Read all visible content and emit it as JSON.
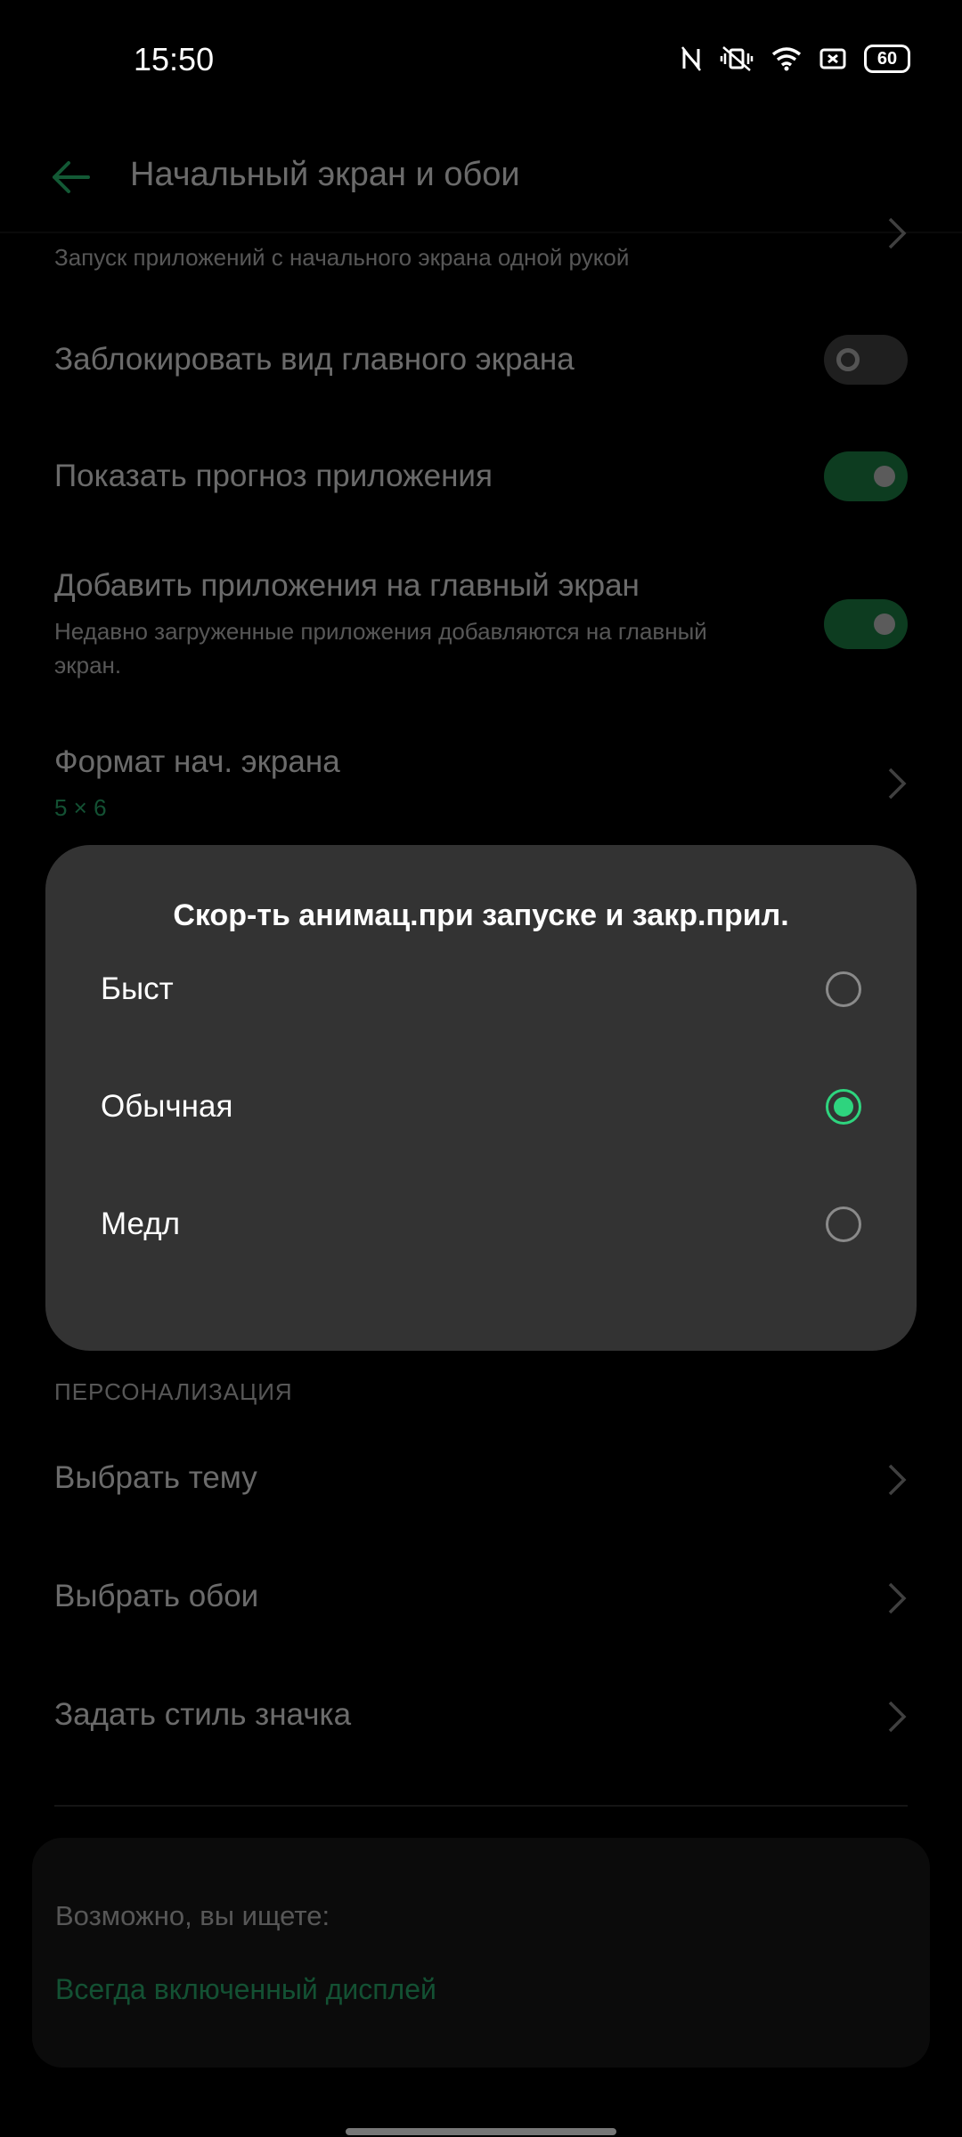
{
  "status_bar": {
    "time": "15:50",
    "battery": "60",
    "icons": [
      "nfc-icon",
      "vibrate-icon",
      "wifi-icon",
      "screen-cast-icon",
      "battery-icon"
    ]
  },
  "app_bar": {
    "title": "Начальный экран и обои"
  },
  "settings": {
    "partial_subtitle": "Запуск приложений с начального экрана одной рукой",
    "lock_layout": {
      "label": "Заблокировать вид главного экрана",
      "enabled": false
    },
    "app_suggestions": {
      "label": "Показать прогноз приложения",
      "enabled": true
    },
    "add_apps": {
      "label": "Добавить приложения на главный экран",
      "subtitle": "Недавно загруженные приложения добавляются на главный экран.",
      "enabled": true
    },
    "grid_format": {
      "label": "Формат нач. экрана",
      "value": "5 × 6"
    }
  },
  "personalization": {
    "header": "ПЕРСОНАЛИЗАЦИЯ",
    "items": [
      {
        "label": "Выбрать тему"
      },
      {
        "label": "Выбрать обои"
      },
      {
        "label": "Задать стиль значка"
      }
    ]
  },
  "suggestions": {
    "label": "Возможно, вы ищете:",
    "link": "Всегда включенный дисплей"
  },
  "dialog": {
    "title": "Скор-ть анимац.при запуске и закр.прил.",
    "options": [
      {
        "label": "Быст",
        "selected": false
      },
      {
        "label": "Обычная",
        "selected": true
      },
      {
        "label": "Медл",
        "selected": false
      }
    ]
  },
  "colors": {
    "accent": "#2ed47e",
    "toggle_on": "#1f8f4e",
    "dialog_bg": "#333333"
  }
}
